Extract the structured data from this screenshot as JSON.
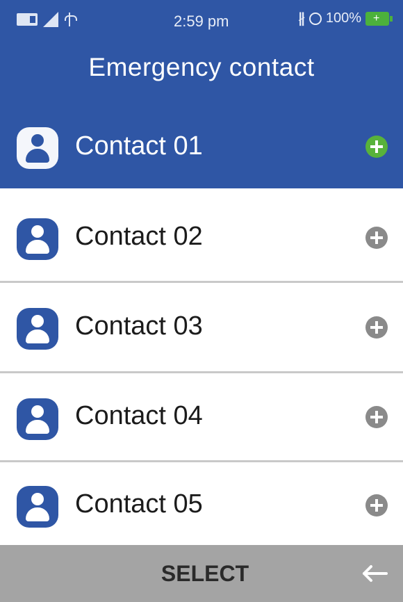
{
  "status_bar": {
    "time": "2:59 pm",
    "battery_text": "100%",
    "icons": [
      "sim-icon",
      "signal-icon",
      "usb-icon",
      "bluetooth-icon",
      "alarm-icon",
      "battery-charging-icon"
    ],
    "bluetooth_glyph": "∦",
    "battery_bolt": "+"
  },
  "header": {
    "title": "Emergency contact"
  },
  "contacts": [
    {
      "label": "Contact 01",
      "selected": true
    },
    {
      "label": "Contact 02",
      "selected": false
    },
    {
      "label": "Contact 03",
      "selected": false
    },
    {
      "label": "Contact 04",
      "selected": false
    },
    {
      "label": "Contact 05",
      "selected": false
    }
  ],
  "bottom_bar": {
    "select_label": "SELECT",
    "back_icon": "back-arrow-icon"
  },
  "colors": {
    "primary": "#2f56a5",
    "add_active": "#58b23b",
    "add_inactive": "#8a8a8a",
    "bottom_bar": "#a4a4a4"
  }
}
